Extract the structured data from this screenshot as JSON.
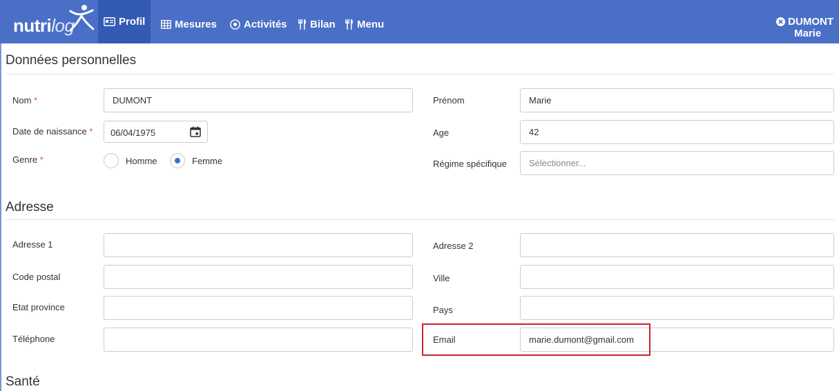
{
  "brand": {
    "logo_main": "nutri",
    "logo_accent": "log"
  },
  "nav": {
    "items": [
      {
        "label": "Profil",
        "icon": "id-card-icon"
      },
      {
        "label": "Mesures",
        "icon": "table-icon"
      },
      {
        "label": "Activités",
        "icon": "soccer-ball-icon"
      },
      {
        "label": "Bilan",
        "icon": "cutlery-icon"
      },
      {
        "label": "Menu",
        "icon": "cutlery-icon"
      }
    ],
    "active": "Profil"
  },
  "user": {
    "last_name": "DUMONT",
    "first_name": "Marie",
    "icon": "close-circle-icon"
  },
  "colors": {
    "navbar": "#4a6fc7",
    "navbar_active": "#345bb4",
    "required": "#d9534f",
    "radio_checked": "#3b6fd1",
    "highlight": "#c8232c"
  },
  "personal": {
    "title": "Données personnelles",
    "nom": {
      "label": "Nom",
      "value": "DUMONT"
    },
    "prenom": {
      "label": "Prénom",
      "value": "Marie"
    },
    "date_naissance": {
      "label": "Date de naissance",
      "value": "06/04/1975"
    },
    "age": {
      "label": "Age",
      "value": "42"
    },
    "genre": {
      "label": "Genre",
      "options": [
        "Homme",
        "Femme"
      ],
      "selected": "Femme"
    },
    "regime": {
      "label": "Régime spécifique",
      "placeholder": "Sélectionner..."
    },
    "required_mark": "*"
  },
  "address": {
    "title": "Adresse",
    "adresse1": {
      "label": "Adresse 1",
      "value": ""
    },
    "adresse2": {
      "label": "Adresse 2",
      "value": ""
    },
    "code_postal": {
      "label": "Code postal",
      "value": ""
    },
    "ville": {
      "label": "Ville",
      "value": ""
    },
    "etat_province": {
      "label": "Etat province",
      "value": ""
    },
    "pays": {
      "label": "Pays",
      "value": ""
    },
    "telephone": {
      "label": "Téléphone",
      "value": ""
    },
    "email": {
      "label": "Email",
      "value": "marie.dumont@gmail.com"
    }
  },
  "health": {
    "title": "Santé"
  }
}
